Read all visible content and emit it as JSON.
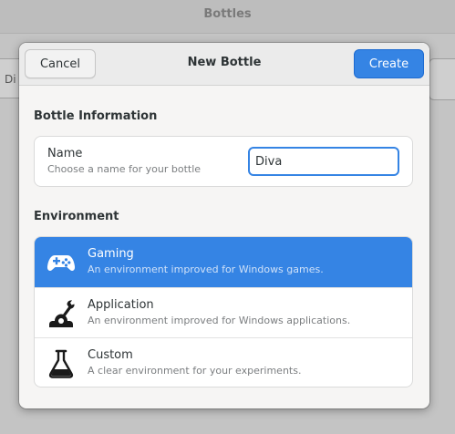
{
  "background": {
    "window_title": "Bottles",
    "left_button_text": "Di"
  },
  "dialog": {
    "title": "New Bottle",
    "cancel_label": "Cancel",
    "create_label": "Create",
    "accent_color": "#3584e4"
  },
  "bottle_info": {
    "heading": "Bottle Information",
    "name_label": "Name",
    "name_hint": "Choose a name for your bottle",
    "name_value": "Diva"
  },
  "environment": {
    "heading": "Environment",
    "options": [
      {
        "title": "Gaming",
        "description": "An environment improved for Windows games.",
        "icon": "gamepad-icon",
        "selected": true
      },
      {
        "title": "Application",
        "description": "An environment improved for Windows applications.",
        "icon": "wrench-gear-icon",
        "selected": false
      },
      {
        "title": "Custom",
        "description": "A clear environment for your experiments.",
        "icon": "flask-icon",
        "selected": false
      }
    ]
  }
}
